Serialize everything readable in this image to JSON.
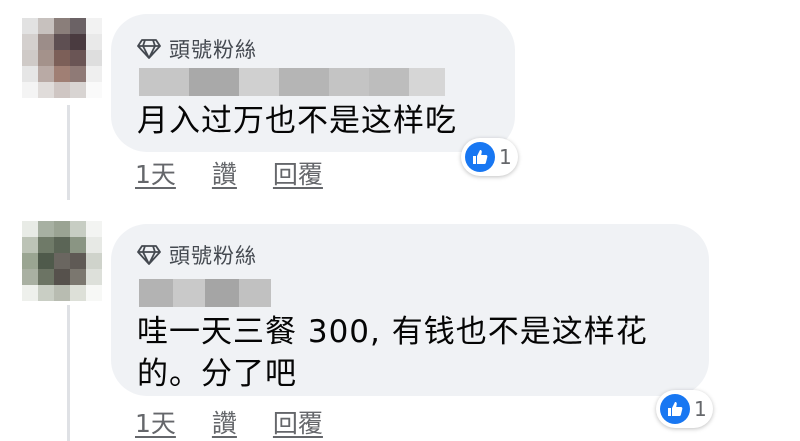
{
  "comments": [
    {
      "badge": "頭號粉絲",
      "text_lines": [
        "月入过万也不是这样吃"
      ],
      "actions": {
        "time": "1天",
        "like": "讚",
        "reply": "回覆"
      },
      "reaction_count": "1"
    },
    {
      "badge": "頭號粉絲",
      "text_lines": [
        "哇一天三餐 300, 有钱也不是这样花",
        "的。分了吧"
      ],
      "actions": {
        "time": "1天",
        "like": "讚",
        "reply": "回覆"
      },
      "reaction_count": "1"
    }
  ],
  "icons": {
    "badge": "diamond-icon",
    "reaction": "like-thumb-icon"
  },
  "colors": {
    "bubble": "#f0f2f5",
    "like_blue": "#1877f2",
    "meta_text": "#65676b"
  }
}
